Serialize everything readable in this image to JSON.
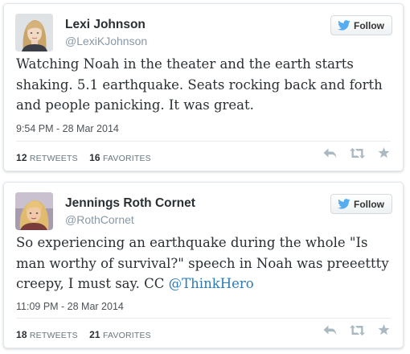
{
  "tweets": [
    {
      "display_name": "Lexi Johnson",
      "screen_name": "@LexiKJohnson",
      "follow_label": "Follow",
      "text": "Watching Noah in the theater and the earth starts shaking. 5.1 earthquake. Seats rocking back and forth and people panicking. It was great.",
      "timestamp": "9:54 PM - 28 Mar 2014",
      "retweets": "12",
      "retweets_label": "RETWEETS",
      "favorites": "16",
      "favorites_label": "FAVORITES"
    },
    {
      "display_name": "Jennings Roth Cornet",
      "screen_name": "@RothCornet",
      "follow_label": "Follow",
      "text": "So experiencing an earthquake during the whole \"Is man worthy of survival?\" speech in Noah was preeettty creepy, I must say. CC",
      "mention": "@ThinkHero",
      "timestamp": "11:09 PM - 28 Mar 2014",
      "retweets": "18",
      "retweets_label": "RETWEETS",
      "favorites": "21",
      "favorites_label": "FAVORITES"
    }
  ],
  "colors": {
    "twitter_blue": "#55acee",
    "link": "#2b7bb9",
    "muted_text": "#8899a6",
    "action_icon": "#aab8c2"
  },
  "icons": [
    "twitter-bird-icon",
    "reply-icon",
    "retweet-icon",
    "favorite-star-icon"
  ]
}
